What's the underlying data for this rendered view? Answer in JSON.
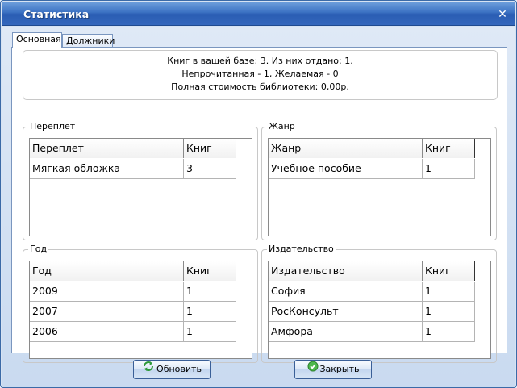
{
  "window": {
    "title": "Статистика"
  },
  "tabs": [
    {
      "label": "Основная"
    },
    {
      "label": "Должники"
    }
  ],
  "summary": {
    "line1": "Книг в вашей базе: 3. Из них отдано: 1.",
    "line2": "Непрочитанная - 1, Желаемая - 0",
    "line3": "Полная стоимость библиотеки: 0,00р."
  },
  "binding": {
    "group_label": "Переплет",
    "columns": [
      "Переплет",
      "Книг"
    ],
    "rows": [
      [
        "Мягкая обложка",
        "3"
      ]
    ]
  },
  "genre": {
    "group_label": "Жанр",
    "columns": [
      "Жанр",
      "Книг"
    ],
    "rows": [
      [
        "Учебное пособие",
        "1"
      ]
    ]
  },
  "year": {
    "group_label": "Год",
    "columns": [
      "Год",
      "Книг"
    ],
    "rows": [
      [
        "2009",
        "1"
      ],
      [
        "2007",
        "1"
      ],
      [
        "2006",
        "1"
      ]
    ]
  },
  "publisher": {
    "group_label": "Издательство",
    "columns": [
      "Издательство",
      "Книг"
    ],
    "rows": [
      [
        "София",
        "1"
      ],
      [
        "РосКонсульт",
        "1"
      ],
      [
        "Амфора",
        "1"
      ]
    ]
  },
  "buttons": {
    "refresh_label": "Обновить",
    "close_label": "Закрыть"
  },
  "icons": {
    "refresh": "refresh-icon",
    "ok": "check-circle-icon",
    "close": "close-icon"
  },
  "colors": {
    "titlebar": "#2a5db3",
    "ok_green": "#3aa53a"
  }
}
